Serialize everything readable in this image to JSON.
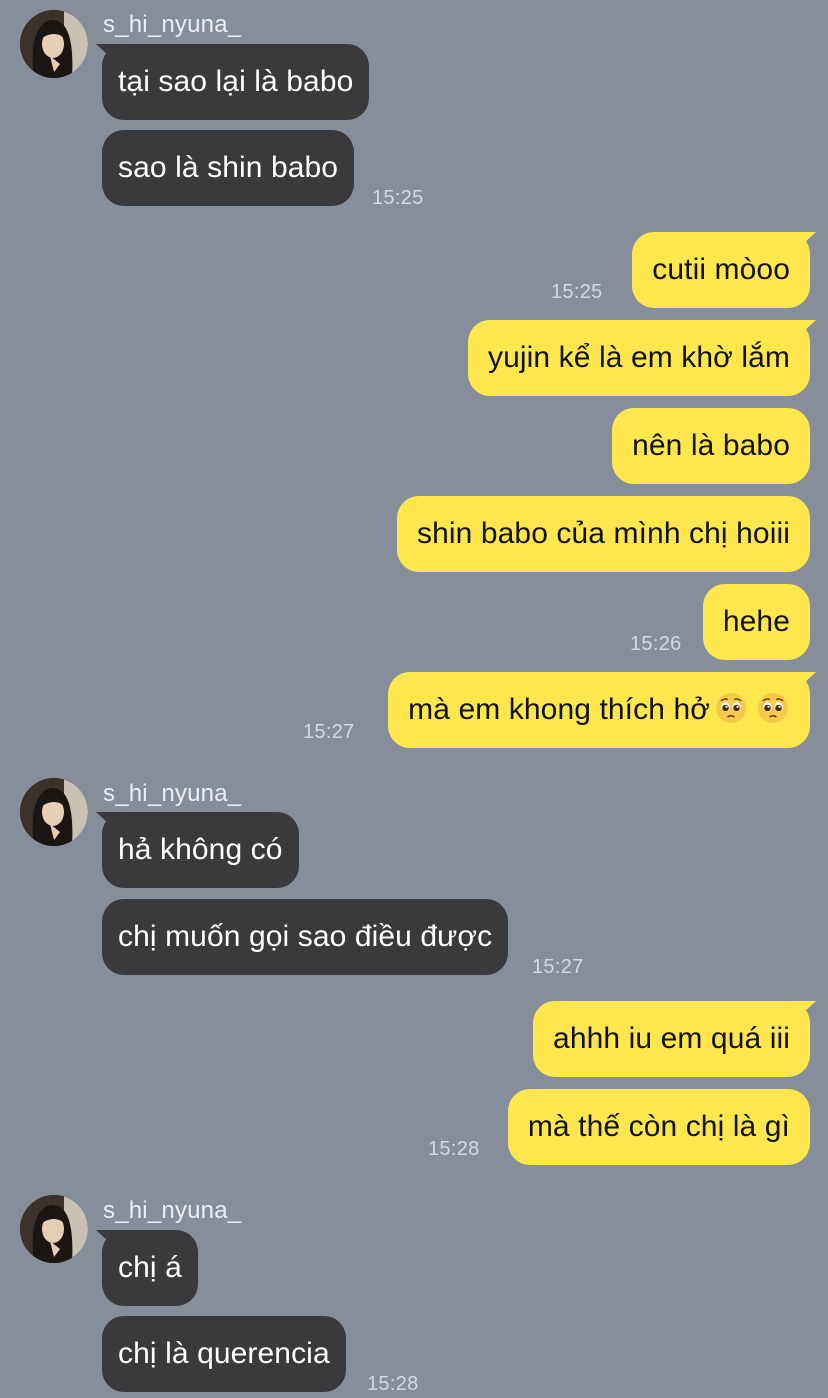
{
  "group1": {
    "sender": "s_hi_nyuna_",
    "messages": [
      "tại sao lại là babo",
      "sao là shin babo"
    ],
    "time": "15:25"
  },
  "group2": {
    "messages": [
      "cutii mòoo"
    ],
    "time": "15:25"
  },
  "group3": {
    "messages": [
      "yujin kể là em khờ lắm",
      "nên là babo",
      "shin babo của mình chị hoiii",
      "hehe"
    ],
    "time": "15:26"
  },
  "group4": {
    "messages": [
      "mà em khong thích hở"
    ],
    "emojis": [
      "pleading-face",
      "pleading-face"
    ],
    "time": "15:27"
  },
  "group5": {
    "sender": "s_hi_nyuna_",
    "messages": [
      "hả không có",
      "chị muốn gọi sao điều được"
    ],
    "time": "15:27"
  },
  "group6": {
    "messages": [
      "ahhh iu em quá iii",
      "mà thế còn chị là gì"
    ],
    "time": "15:28"
  },
  "group7": {
    "sender": "s_hi_nyuna_",
    "messages": [
      "chị á",
      "chị là querencia"
    ],
    "time": "15:28"
  },
  "colors": {
    "background": "#868d9b",
    "incoming_bubble": "#3a3a3c",
    "outgoing_bubble": "#fde74c",
    "timestamp": "#d4d8df"
  }
}
